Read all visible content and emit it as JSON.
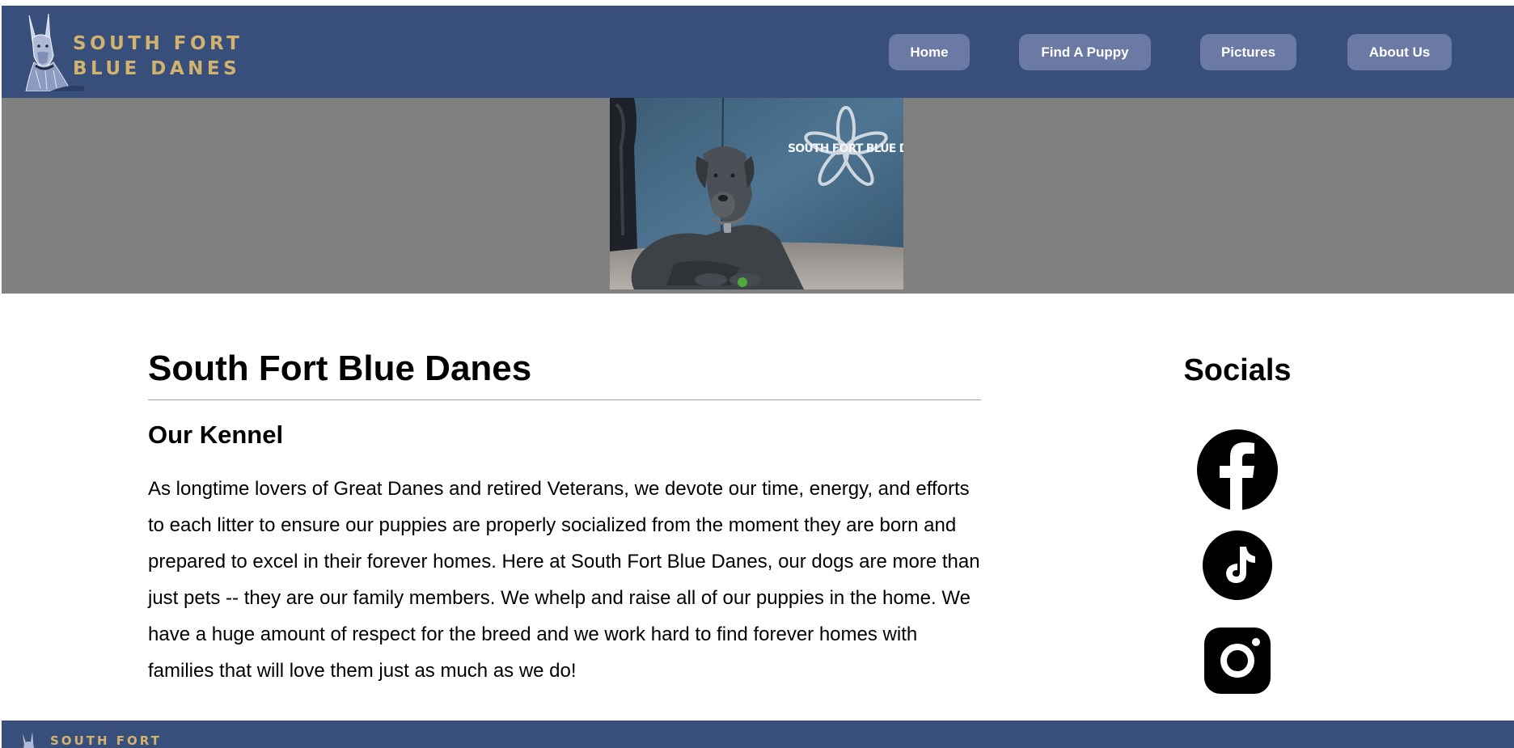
{
  "brand": {
    "line1": "SOUTH FORT",
    "line2": "BLUE DANES",
    "text_color": "#d2b26f"
  },
  "nav": {
    "items": [
      {
        "label": "Home"
      },
      {
        "label": "Find A Puppy"
      },
      {
        "label": "Pictures"
      },
      {
        "label": "About Us"
      }
    ],
    "bar_color": "#394f7b",
    "button_color": "#6b7aa5"
  },
  "hero": {
    "watermark": "SOUTH FORT BLUE DANES",
    "background_color": "#808080"
  },
  "main": {
    "title": "South Fort Blue Danes",
    "section_heading": "Our Kennel",
    "paragraph": "As longtime lovers of Great Danes and retired Veterans, we devote our time, energy, and efforts to each litter to ensure our puppies are properly socialized from the moment they are born and prepared to excel in their forever homes. Here at South Fort Blue Danes, our dogs are more than just pets -- they are our family members. We whelp and raise all of our puppies in the home. We have a huge amount of respect for the breed and we work hard to find forever homes with families that will love them just as much as we do!"
  },
  "socials": {
    "heading": "Socials",
    "links": [
      {
        "icon": "facebook-icon"
      },
      {
        "icon": "tiktok-icon"
      },
      {
        "icon": "instagram-icon"
      }
    ]
  },
  "footer": {
    "brand_line1": "SOUTH FORT"
  }
}
